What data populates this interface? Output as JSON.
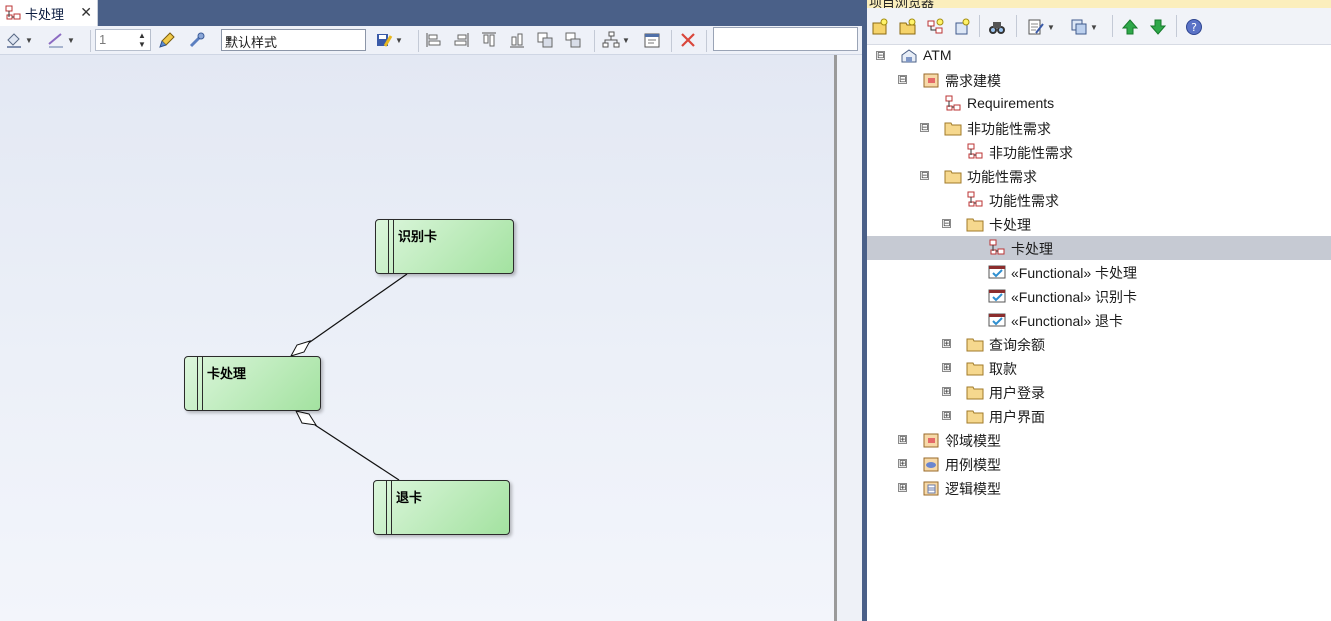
{
  "diagram_tab": {
    "label": "卡处理",
    "close": "✕"
  },
  "toolbar": {
    "line_width": "1",
    "style": "默认样式"
  },
  "diagram": {
    "nodes": {
      "shibie": "识别卡",
      "kachuli": "卡处理",
      "tuika": "退卡"
    }
  },
  "browser": {
    "title": "项目浏览器",
    "tree": [
      {
        "label": "ATM",
        "expander": "⊟"
      },
      {
        "label": "需求建模",
        "expander": "⊟"
      },
      {
        "label": "Requirements"
      },
      {
        "label": "非功能性需求",
        "expander": "⊟"
      },
      {
        "label": "非功能性需求"
      },
      {
        "label": "功能性需求",
        "expander": "⊟"
      },
      {
        "label": "功能性需求"
      },
      {
        "label": "卡处理",
        "expander": "⊟"
      },
      {
        "label": "卡处理"
      },
      {
        "label": "«Functional» 卡处理"
      },
      {
        "label": "«Functional» 识别卡"
      },
      {
        "label": "«Functional» 退卡"
      },
      {
        "label": "查询余额",
        "expander": "⊞"
      },
      {
        "label": "取款",
        "expander": "⊞"
      },
      {
        "label": "用户登录",
        "expander": "⊞"
      },
      {
        "label": "用户界面",
        "expander": "⊞"
      },
      {
        "label": "邻域模型",
        "expander": "⊞"
      },
      {
        "label": "用例模型",
        "expander": "⊞"
      },
      {
        "label": "逻辑模型",
        "expander": "⊞"
      }
    ]
  },
  "colors": {
    "chrome": "#4a6088",
    "node_fill": "#a3e2a0",
    "selected_row": "#c6cad3"
  }
}
